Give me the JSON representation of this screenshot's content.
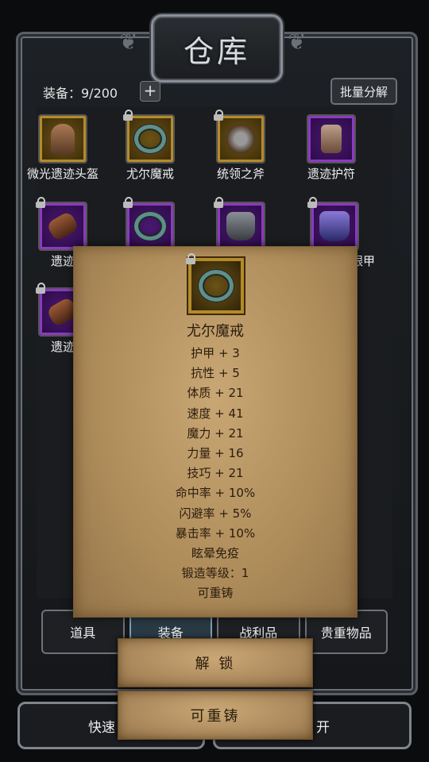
{
  "header": {
    "title": "仓库"
  },
  "inventory": {
    "count_text": "装备：9/200",
    "add_symbol": "+",
    "batch_label": "批量分解",
    "items": [
      {
        "label": "微光遗迹头盔",
        "rarity": "gold",
        "icon": "helmet-icon",
        "locked": false
      },
      {
        "label": "尤尔魔戒",
        "rarity": "gold",
        "icon": "ring-icon",
        "locked": true
      },
      {
        "label": "统领之斧",
        "rarity": "gold",
        "icon": "axe-icon",
        "locked": true
      },
      {
        "label": "遗迹护符",
        "rarity": "purple",
        "icon": "amulet-icon",
        "locked": false
      },
      {
        "label": "遗迹",
        "rarity": "purple",
        "icon": "bracer-icon",
        "locked": true
      },
      {
        "label": "",
        "rarity": "purple",
        "icon": "ring-icon",
        "locked": true
      },
      {
        "label": "",
        "rarity": "purple",
        "icon": "chest-armor-icon",
        "locked": true
      },
      {
        "label": "秘银甲",
        "rarity": "purple",
        "icon": "mithril-armor-icon",
        "locked": true
      },
      {
        "label": "遗迹",
        "rarity": "purple",
        "icon": "bracer-icon",
        "locked": true
      }
    ]
  },
  "tabs": [
    "道具",
    "装备",
    "战利品",
    "贵重物品"
  ],
  "bottom_buttons": [
    "快速",
    "开"
  ],
  "popup": {
    "item_name": "尤尔魔戒",
    "stats": [
      "护甲 + 3",
      "抗性 + 5",
      "体质 + 21",
      "速度 + 41",
      "魔力 + 21",
      "力量 + 16",
      "技巧 + 21",
      "命中率 + 10%",
      "闪避率 + 5%",
      "暴击率 + 10%",
      "眩晕免疫",
      "锻造等级：1",
      "可重铸"
    ],
    "unlock_label": "解 锁",
    "reforge_label": "可重铸"
  },
  "colors": {
    "rarity_gold": "#b48b2a",
    "rarity_purple": "#8a3ac0",
    "parchment": "#c9a775"
  }
}
